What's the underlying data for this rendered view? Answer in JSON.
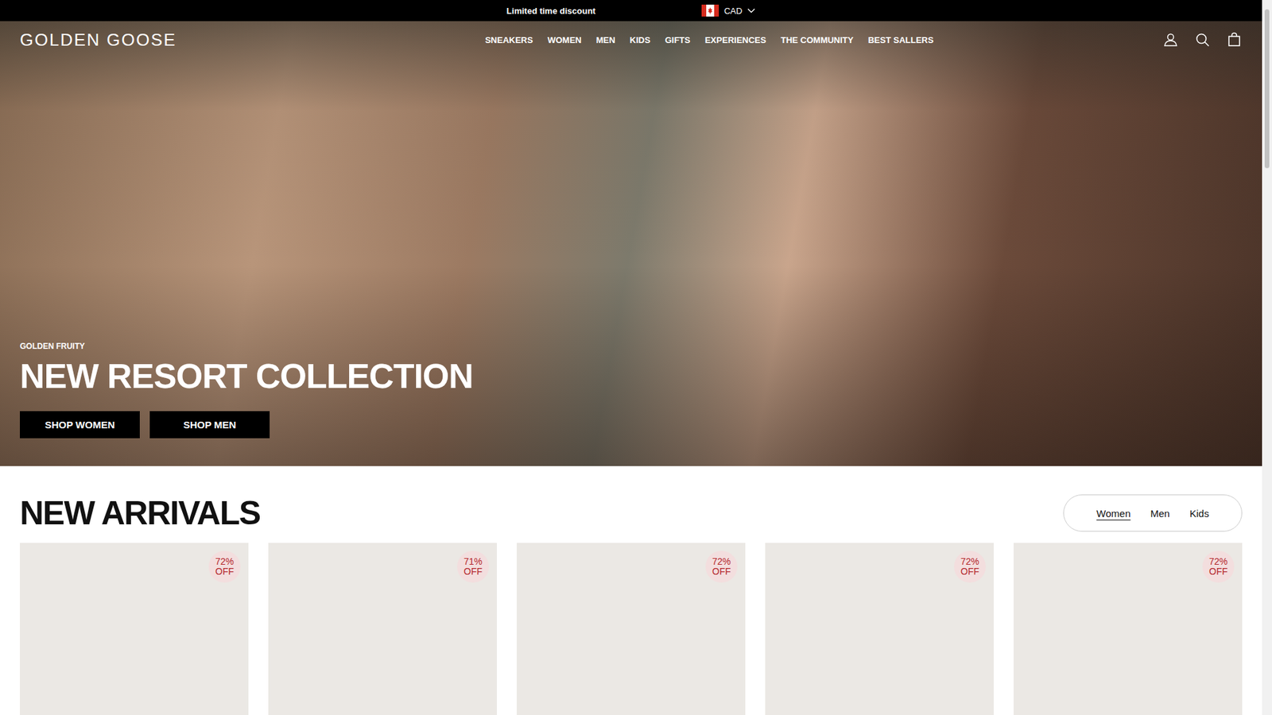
{
  "announcement": {
    "text": "Limited time discount"
  },
  "currency": {
    "label": "CAD"
  },
  "header": {
    "logo": "GOLDEN GOOSE",
    "nav": [
      "SNEAKERS",
      "WOMEN",
      "MEN",
      "KIDS",
      "GIFTS",
      "EXPERIENCES",
      "THE COMMUNITY",
      "BEST SALLERS"
    ]
  },
  "hero": {
    "eyebrow": "GOLDEN FRUITY",
    "title": "NEW RESORT COLLECTION",
    "buttons": [
      "SHOP WOMEN",
      "SHOP MEN"
    ]
  },
  "new_arrivals": {
    "title": "NEW ARRIVALS",
    "tabs": [
      {
        "label": "Women",
        "selected": true
      },
      {
        "label": "Men",
        "selected": false
      },
      {
        "label": "Kids",
        "selected": false
      }
    ],
    "products": [
      {
        "discount": "72%",
        "suffix": "OFF"
      },
      {
        "discount": "71%",
        "suffix": "OFF"
      },
      {
        "discount": "72%",
        "suffix": "OFF"
      },
      {
        "discount": "72%",
        "suffix": "OFF"
      },
      {
        "discount": "72%",
        "suffix": "OFF"
      }
    ]
  }
}
